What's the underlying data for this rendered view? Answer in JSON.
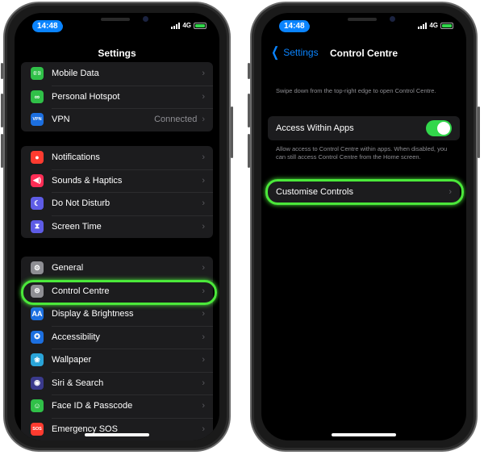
{
  "left_screen": {
    "status": {
      "time": "14:48",
      "network": "4G"
    },
    "title": "Settings",
    "groups": [
      [
        {
          "label": "Mobile Data",
          "value": "",
          "icon": "antenna-icon",
          "color": "#30c048",
          "glyph": "((·))"
        },
        {
          "label": "Personal Hotspot",
          "value": "",
          "icon": "hotspot-icon",
          "color": "#30c048",
          "glyph": "∞"
        },
        {
          "label": "VPN",
          "value": "Connected",
          "icon": "vpn-icon",
          "color": "#1c6fe0",
          "glyph": "VPN"
        }
      ],
      [
        {
          "label": "Notifications",
          "value": "",
          "icon": "notifications-icon",
          "color": "#ff3b30",
          "glyph": "●"
        },
        {
          "label": "Sounds & Haptics",
          "value": "",
          "icon": "speaker-icon",
          "color": "#ff2d55",
          "glyph": "◀)"
        },
        {
          "label": "Do Not Disturb",
          "value": "",
          "icon": "moon-icon",
          "color": "#5e5ce6",
          "glyph": "☾"
        },
        {
          "label": "Screen Time",
          "value": "",
          "icon": "hourglass-icon",
          "color": "#5e5ce6",
          "glyph": "⧗"
        }
      ],
      [
        {
          "label": "General",
          "value": "",
          "icon": "gear-icon",
          "color": "#8e8e93",
          "glyph": "⚙"
        },
        {
          "label": "Control Centre",
          "value": "",
          "icon": "toggles-icon",
          "color": "#8e8e93",
          "glyph": "⊜"
        },
        {
          "label": "Display & Brightness",
          "value": "",
          "icon": "text-size-icon",
          "color": "#1c6fe0",
          "glyph": "AA"
        },
        {
          "label": "Accessibility",
          "value": "",
          "icon": "accessibility-icon",
          "color": "#1c6fe0",
          "glyph": "✪"
        },
        {
          "label": "Wallpaper",
          "value": "",
          "icon": "flower-icon",
          "color": "#2aa4d8",
          "glyph": "❀"
        },
        {
          "label": "Siri & Search",
          "value": "",
          "icon": "siri-icon",
          "color": "#3a3a8c",
          "glyph": "◉"
        },
        {
          "label": "Face ID & Passcode",
          "value": "",
          "icon": "face-id-icon",
          "color": "#30c048",
          "glyph": "☺"
        },
        {
          "label": "Emergency SOS",
          "value": "",
          "icon": "sos-icon",
          "color": "#ff3b30",
          "glyph": "SOS"
        }
      ]
    ]
  },
  "right_screen": {
    "status": {
      "time": "14:48",
      "network": "4G"
    },
    "back_label": "Settings",
    "title": "Control Centre",
    "intro_text": "Swipe down from the top-right edge to open Control Centre.",
    "access_within_apps": {
      "label": "Access Within Apps",
      "enabled": true
    },
    "access_description": "Allow access to Control Centre within apps. When disabled, you can still access Control Centre from the Home screen.",
    "customise_controls": {
      "label": "Customise Controls"
    }
  },
  "colors": {
    "accent": "#0a84ff",
    "highlight": "#4be83a",
    "toggle_on": "#32d74b",
    "cell_bg": "#1c1c1e"
  },
  "chevron": "›"
}
